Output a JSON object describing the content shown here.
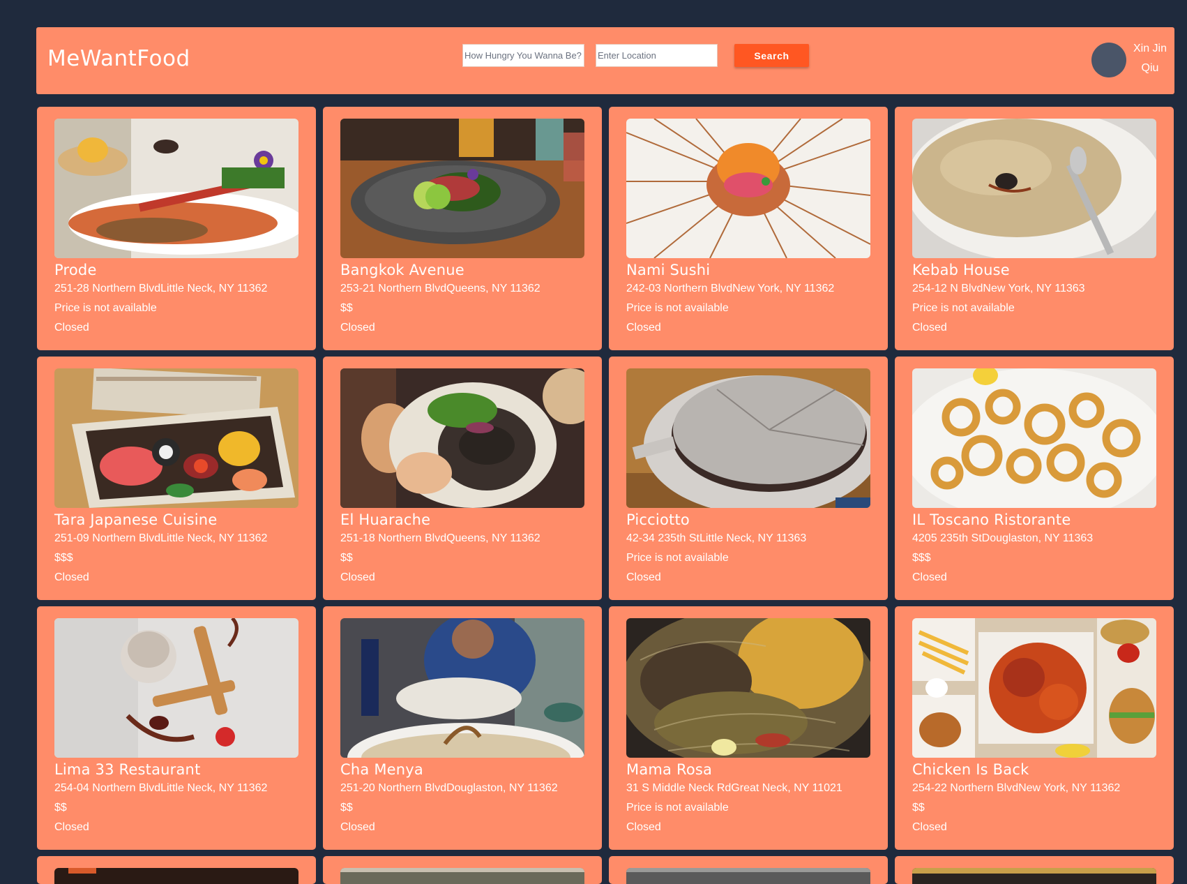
{
  "header": {
    "brand": "MeWantFood",
    "hunger_placeholder": "How Hungry You Wanna Be?",
    "location_placeholder": "Enter Location",
    "search_label": "Search",
    "user_name": "Xin Jin Qiu"
  },
  "colors": {
    "background": "#1f2a3d",
    "card": "#ff8c69",
    "button": "#ff5722",
    "avatar": "#4a5568"
  },
  "restaurants": [
    {
      "name": "Prode",
      "address": "251-28 Northern BlvdLittle Neck, NY 11362",
      "price": "Price is not available",
      "status": "Closed",
      "image": "grilled-seafood-platter"
    },
    {
      "name": "Bangkok Avenue",
      "address": "253-21 Northern BlvdQueens, NY 11362",
      "price": "$$",
      "status": "Closed",
      "image": "plate-with-lime"
    },
    {
      "name": "Nami Sushi",
      "address": "242-03 Northern BlvdNew York, NY 11362",
      "price": "Price is not available",
      "status": "Closed",
      "image": "uni-sushi-plate"
    },
    {
      "name": "Kebab House",
      "address": "254-12 N BlvdNew York, NY 11363",
      "price": "Price is not available",
      "status": "Closed",
      "image": "hummus-bowl"
    },
    {
      "name": "Tara Japanese Cuisine",
      "address": "251-09 Northern BlvdLittle Neck, NY 11362",
      "price": "$$$",
      "status": "Closed",
      "image": "sushi-box"
    },
    {
      "name": "El Huarache",
      "address": "251-18 Northern BlvdQueens, NY 11362",
      "price": "$$",
      "status": "Closed",
      "image": "sandwich"
    },
    {
      "name": "Picciotto",
      "address": "42-34 235th StLittle Neck, NY 11363",
      "price": "Price is not available",
      "status": "Closed",
      "image": "sugar-cake"
    },
    {
      "name": "IL Toscano Ristorante",
      "address": "4205 235th StDouglaston, NY 11363",
      "price": "$$$",
      "status": "Closed",
      "image": "fried-calamari"
    },
    {
      "name": "Lima 33 Restaurant",
      "address": "254-04 Northern BlvdLittle Neck, NY 11362",
      "price": "$$",
      "status": "Closed",
      "image": "ice-cream-dessert"
    },
    {
      "name": "Cha Menya",
      "address": "251-20 Northern BlvdDouglaston, NY 11362",
      "price": "$$",
      "status": "Closed",
      "image": "ramen-bowl"
    },
    {
      "name": "Mama Rosa",
      "address": "31 S Middle Neck RdGreat Neck, NY 11021",
      "price": "Price is not available",
      "status": "Closed",
      "image": "takeout-rice-beef"
    },
    {
      "name": "Chicken Is Back",
      "address": "254-22 Northern BlvdNew York, NY 11362",
      "price": "$$",
      "status": "Closed",
      "image": "fried-chicken-spread"
    }
  ]
}
